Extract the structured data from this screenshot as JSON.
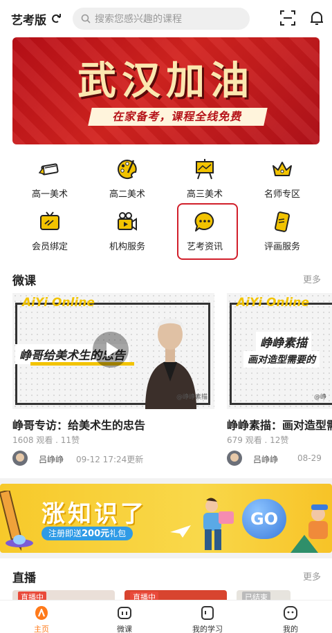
{
  "header": {
    "app_name": "艺考版",
    "search_placeholder": "搜索您感兴趣的课程"
  },
  "banner": {
    "title": "武汉加油",
    "subtitle": "在家备考，课程全线免费"
  },
  "grid": [
    {
      "label": "高一美术",
      "icon": "pencil-icon"
    },
    {
      "label": "高二美术",
      "icon": "palette-icon"
    },
    {
      "label": "高三美术",
      "icon": "easel-icon"
    },
    {
      "label": "名师专区",
      "icon": "crown-icon"
    },
    {
      "label": "会员绑定",
      "icon": "tv-icon"
    },
    {
      "label": "机构服务",
      "icon": "video-camera-icon"
    },
    {
      "label": "艺考资讯",
      "icon": "chat-bubble-icon"
    },
    {
      "label": "评画服务",
      "icon": "phone-icon"
    }
  ],
  "micro": {
    "title": "微课",
    "more": "更多",
    "cards": [
      {
        "brand": "AiYi Online",
        "headline": "峥哥给美术生的忠告",
        "watermark": "@峥峥素描",
        "title": "峥哥专访：给美术生的忠告",
        "stats": "1608 观看 . 11赞",
        "author": "吕峥峥",
        "time": "09-12 17:24更新"
      },
      {
        "brand": "AiYi Online",
        "headline": "峥峥素描",
        "headline2": "画对造型需要的",
        "watermark": "@峥",
        "title": "峥峥素描：画对造型需要的",
        "stats": "679 观看 . 12赞",
        "author": "吕峥峥",
        "time": "08-29"
      }
    ]
  },
  "promo": {
    "title": "涨知识了",
    "pill_pre": "注册即送",
    "pill_amount": "200元",
    "pill_post": "礼包",
    "go": "GO"
  },
  "live": {
    "title": "直播",
    "more": "更多",
    "tags": [
      "直播中",
      "直播中",
      "已结束"
    ]
  },
  "tabbar": [
    {
      "label": "主页",
      "active": true
    },
    {
      "label": "微课",
      "active": false
    },
    {
      "label": "我的学习",
      "active": false
    },
    {
      "label": "我的",
      "active": false
    }
  ],
  "colors": {
    "accent": "#ff7a1a",
    "highlight": "#d11e2a",
    "yellow": "#f2c300"
  }
}
